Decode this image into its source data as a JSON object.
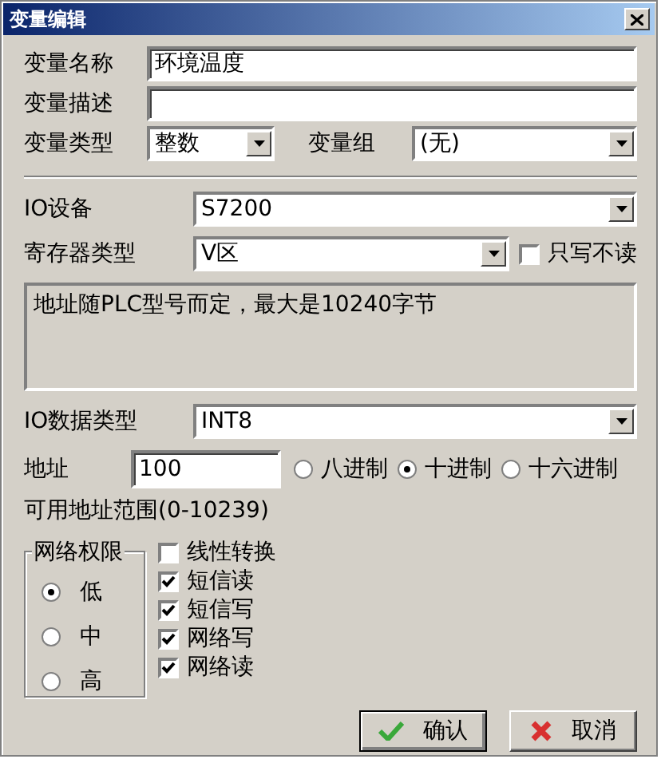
{
  "window": {
    "title": "变量编辑"
  },
  "fields": [
    {
      "label": "变量名称",
      "value": "环境温度"
    },
    {
      "label": "变量描述"
    }
  ],
  "type_row": {
    "label": "变量类型",
    "value": "整数",
    "group_label": "变量组",
    "group_value": "(无)"
  },
  "io_device": {
    "label": "IO设备",
    "value": "S7200"
  },
  "register": {
    "label": "寄存器类型",
    "value": "V区",
    "write_only": {
      "label": "只写不读",
      "checked": false
    }
  },
  "info": "地址随PLC型号而定，最大是10240字节",
  "data_type": {
    "label": "IO数据类型",
    "value": "INT8"
  },
  "address": {
    "label": "地址",
    "value": "100",
    "bases": [
      {
        "label": "八进制",
        "selected": false
      },
      {
        "label": "十进制",
        "selected": true
      },
      {
        "label": "十六进制",
        "selected": false
      }
    ]
  },
  "range": "可用地址范围(0-10239)",
  "permission": {
    "title": "网络权限",
    "levels": [
      {
        "label": "低",
        "selected": true
      },
      {
        "label": "中",
        "selected": false
      },
      {
        "label": "高",
        "selected": false
      }
    ]
  },
  "options": [
    {
      "label": "线性转换",
      "checked": false
    },
    {
      "label": "短信读",
      "checked": true
    },
    {
      "label": "短信写",
      "checked": true
    },
    {
      "label": "网络写",
      "checked": true
    },
    {
      "label": "网络读",
      "checked": true
    }
  ],
  "buttons": [
    {
      "kind": "ok",
      "label": "确认"
    },
    {
      "kind": "cancel",
      "label": "取消"
    }
  ]
}
